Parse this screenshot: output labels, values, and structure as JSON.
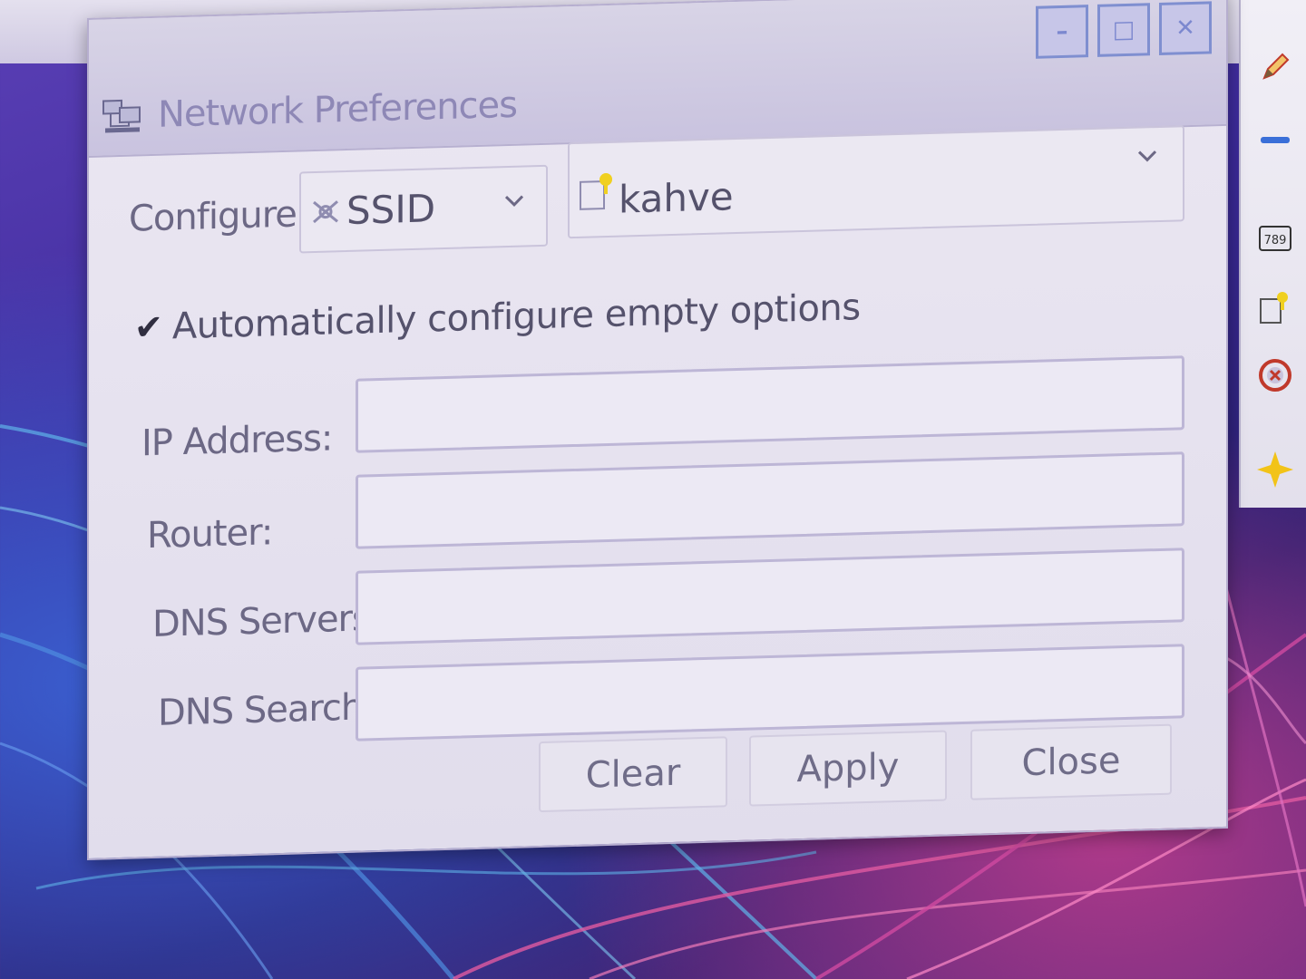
{
  "window": {
    "title": "Network Preferences",
    "minimize_label": "–",
    "maximize_label": "□",
    "close_label": "✕"
  },
  "configure": {
    "label": "Configure:",
    "type_value": "SSID",
    "network_value": "kahve"
  },
  "auto_config": {
    "checked": true,
    "check_glyph": "✔",
    "label": "Automatically configure empty options"
  },
  "fields": {
    "ip_label": "IP Address:",
    "ip_value": "",
    "router_label": "Router:",
    "router_value": "",
    "dns_servers_label": "DNS Servers:",
    "dns_servers_value": "",
    "dns_search_label": "DNS Search:",
    "dns_search_value": ""
  },
  "buttons": {
    "clear": "Clear",
    "apply": "Apply",
    "close": "Close"
  },
  "right_panel": {
    "icons": [
      "pencil-icon",
      "minus-icon",
      "keyboard-icon",
      "wifi-icon",
      "close-circle-icon",
      "star-icon"
    ]
  },
  "colors": {
    "dialog_bg": "#e6e2ef",
    "titlebar_bg": "#cfc9e2",
    "wifi_accent": "#f0d020"
  }
}
